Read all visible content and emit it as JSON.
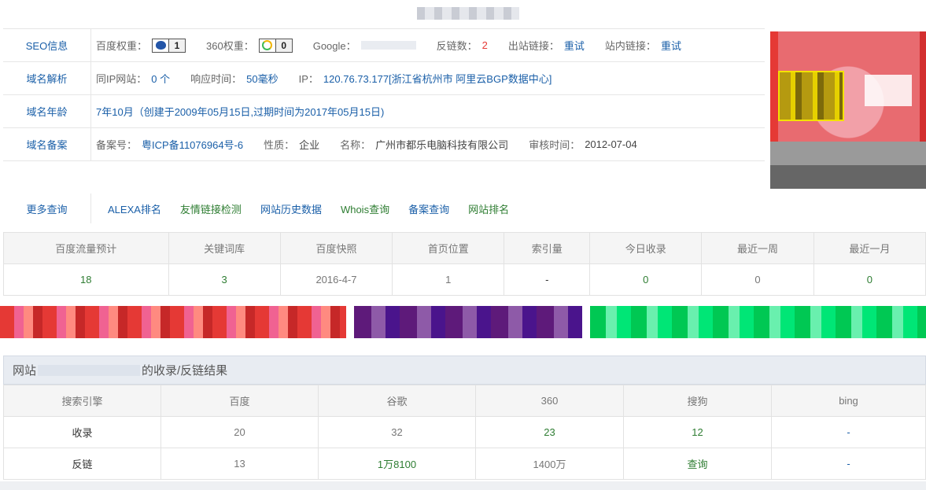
{
  "seo": {
    "label": "SEO信息",
    "baidu_weight_label": "百度权重：",
    "baidu_weight": "1",
    "w360_label": "360权重：",
    "w360": "0",
    "google_label": "Google：",
    "backlinks_label": "反链数：",
    "backlinks": "2",
    "outbound_label": "出站链接：",
    "outbound": "重试",
    "internal_label": "站内链接：",
    "internal": "重试"
  },
  "dns": {
    "label": "域名解析",
    "same_ip_label": "同IP网站：",
    "same_ip": "0 个",
    "response_label": "响应时间：",
    "response": "50毫秒",
    "ip_label": "IP：",
    "ip": "120.76.73.177[浙江省杭州市 阿里云BGP数据中心]"
  },
  "age": {
    "label": "域名年龄",
    "value": "7年10月（创建于2009年05月15日,过期时间为2017年05月15日)"
  },
  "icp": {
    "label": "域名备案",
    "no_label": "备案号：",
    "no": "粤ICP备11076964号-6",
    "nature_label": "性质：",
    "nature": "企业",
    "name_label": "名称：",
    "name": "广州市都乐电脑科技有限公司",
    "time_label": "审核时间：",
    "time": "2012-07-04"
  },
  "more": {
    "label": "更多查询",
    "links": [
      "ALEXA排名",
      "友情链接检测",
      "网站历史数据",
      "Whois查询",
      "备案查询",
      "网站排名"
    ]
  },
  "stats": {
    "headers": [
      "百度流量预计",
      "关键词库",
      "百度快照",
      "首页位置",
      "索引量",
      "今日收录",
      "最近一周",
      "最近一月"
    ],
    "values": [
      "18",
      "3",
      "2016-4-7",
      "1",
      "-",
      "0",
      "0",
      "0"
    ]
  },
  "result": {
    "title_prefix": "网站",
    "title_suffix": "的收录/反链结果",
    "headers": [
      "搜索引擎",
      "百度",
      "谷歌",
      "360",
      "搜狗",
      "bing"
    ],
    "rows": [
      [
        "收录",
        "20",
        "32",
        "23",
        "12",
        "-"
      ],
      [
        "反链",
        "13",
        "1万8100",
        "1400万",
        "查询",
        "-"
      ]
    ]
  },
  "colors": {
    "link_blue": "#1a5fa8",
    "link_green": "#2e7d32",
    "alert_red": "#e53935"
  }
}
